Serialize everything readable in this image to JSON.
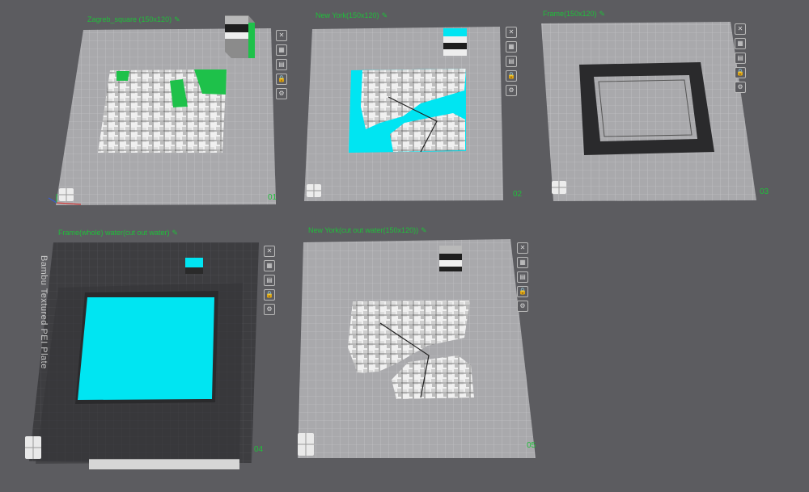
{
  "plates": [
    {
      "title": "Zagreb_square (150x120)",
      "number": "01"
    },
    {
      "title": "New York(150x120)",
      "number": "02"
    },
    {
      "title": "Frame(150x120)",
      "number": "03"
    },
    {
      "title": "Frame(whole) water(cut out water)",
      "number": "04",
      "texture_label": "Bambu Textured PEI Plate"
    },
    {
      "title": "New York(cut out water(150x120))",
      "number": "05"
    }
  ],
  "plate_tools": [
    {
      "icon": "close-icon",
      "glyph": "✕"
    },
    {
      "icon": "arrange-icon",
      "glyph": "▦"
    },
    {
      "icon": "orient-icon",
      "glyph": "▤"
    },
    {
      "icon": "lock-icon",
      "glyph": "🔒"
    },
    {
      "icon": "settings-icon",
      "glyph": "⚙"
    }
  ],
  "edit_glyph": "✎",
  "colors": {
    "title_green": "#1fbf3a",
    "water_cyan": "#00e5f2",
    "model_green": "#1ec14a",
    "plate_light": "#a9a9ac",
    "plate_dark": "#3d3d40"
  }
}
